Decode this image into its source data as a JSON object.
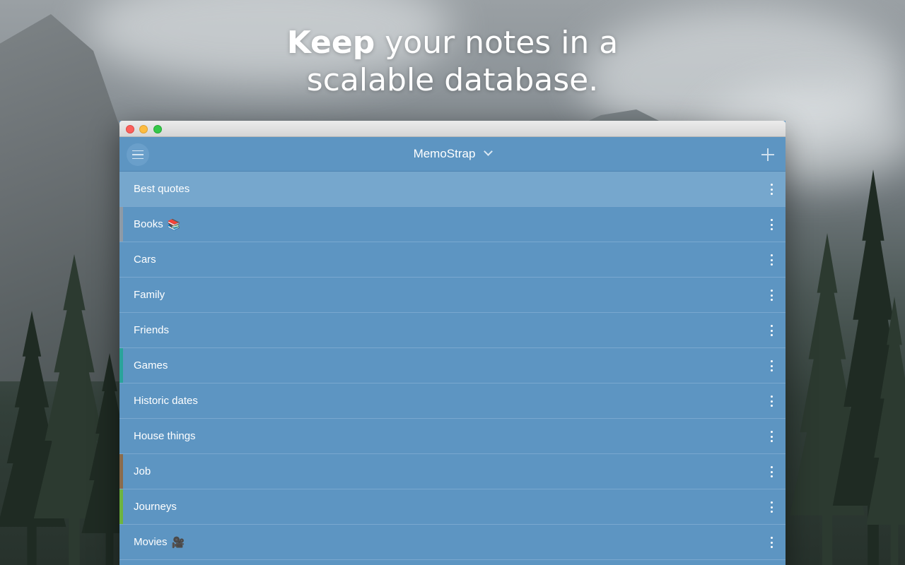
{
  "headline": {
    "bold": "Keep",
    "rest_line1": " your notes in a",
    "line2": "scalable database."
  },
  "window": {
    "app_title": "MemoStrap",
    "menu_icon": "hamburger-icon",
    "title_dropdown_icon": "chevron-down-icon",
    "add_icon": "plus-icon"
  },
  "colors": {
    "list_bg": "#5d95c2",
    "selected_bg": "#76a7cd",
    "tag_gray": "#8e9aa6",
    "tag_teal": "#2aa39a",
    "tag_brown": "#8a6b4c",
    "tag_green": "#6db33f"
  },
  "notebooks": [
    {
      "label": "Best quotes",
      "emoji": "",
      "selected": true,
      "tag": ""
    },
    {
      "label": "Books",
      "emoji": "📚",
      "selected": false,
      "tag": "#8e9aa6"
    },
    {
      "label": "Cars",
      "emoji": "",
      "selected": false,
      "tag": ""
    },
    {
      "label": "Family",
      "emoji": "",
      "selected": false,
      "tag": ""
    },
    {
      "label": "Friends",
      "emoji": "",
      "selected": false,
      "tag": ""
    },
    {
      "label": "Games",
      "emoji": "",
      "selected": false,
      "tag": "#2aa39a"
    },
    {
      "label": "Historic dates",
      "emoji": "",
      "selected": false,
      "tag": ""
    },
    {
      "label": "House things",
      "emoji": "",
      "selected": false,
      "tag": ""
    },
    {
      "label": "Job",
      "emoji": "",
      "selected": false,
      "tag": "#8a6b4c"
    },
    {
      "label": "Journeys",
      "emoji": "",
      "selected": false,
      "tag": "#6db33f"
    },
    {
      "label": "Movies",
      "emoji": "🎥",
      "selected": false,
      "tag": ""
    }
  ]
}
